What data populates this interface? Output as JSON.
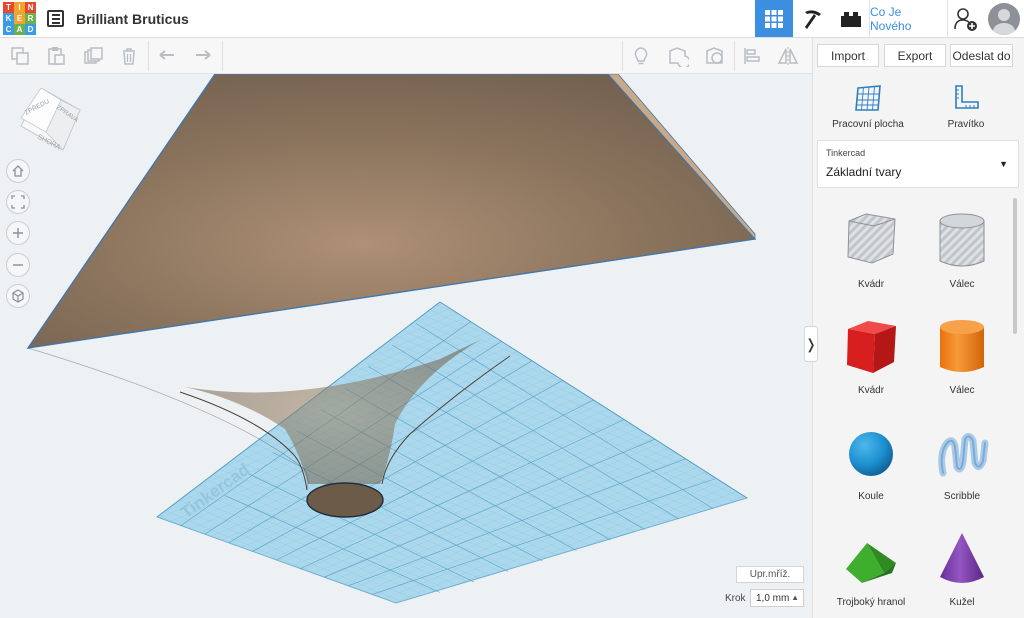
{
  "header": {
    "logo_letters": [
      "T",
      "I",
      "N",
      "K",
      "E",
      "R",
      "C",
      "A",
      "D"
    ],
    "logo_colors": [
      "#e8472f",
      "#f2a329",
      "#e8472f",
      "#3a9be8",
      "#f2a329",
      "#6ab04c",
      "#3a9be8",
      "#6ab04c",
      "#3a9be8"
    ],
    "project_title": "Brilliant Bruticus",
    "news_label": "Co Je Nového",
    "accent": "#3b8ee0"
  },
  "panel": {
    "import_label": "Import",
    "export_label": "Export",
    "send_label": "Odeslat do",
    "workplane_label": "Pracovní plocha",
    "ruler_label": "Pravítko",
    "library_source": "Tinkercad",
    "library_name": "Základní tvary",
    "shapes": [
      {
        "label": "Kvádr",
        "icon": "box-hole-icon",
        "color": "#b8bcc2"
      },
      {
        "label": "Válec",
        "icon": "cylinder-hole-icon",
        "color": "#b8bcc2"
      },
      {
        "label": "Kvádr",
        "icon": "box-icon",
        "color": "#e02424"
      },
      {
        "label": "Válec",
        "icon": "cylinder-icon",
        "color": "#f07d12"
      },
      {
        "label": "Koule",
        "icon": "sphere-icon",
        "color": "#1d8fd0"
      },
      {
        "label": "Scribble",
        "icon": "scribble-icon",
        "color": "#8fb9df"
      },
      {
        "label": "Trojboký hranol",
        "icon": "roof-icon",
        "color": "#3aa82c"
      },
      {
        "label": "Kužel",
        "icon": "cone-icon",
        "color": "#7a3fa8"
      }
    ]
  },
  "viewport": {
    "viewcube_faces": [
      "ZPŘEDU",
      "ZPRAVA",
      "SHORA"
    ],
    "workplane_watermark": "Tinkercad",
    "edit_grid_label": "Upr.mříž.",
    "snap_label": "Krok",
    "snap_value": "1,0 mm"
  }
}
